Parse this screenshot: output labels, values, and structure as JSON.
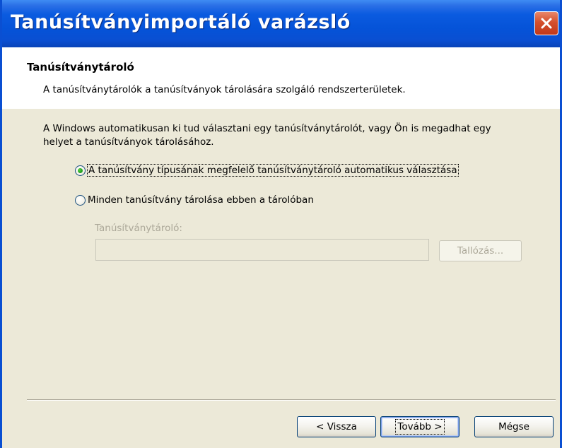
{
  "window": {
    "title": "Tanúsítványimportáló varázsló",
    "close_icon": "close-icon"
  },
  "header": {
    "title": "Tanúsítványtároló",
    "subtitle": "A tanúsítványtárolók a tanúsítványok tárolására szolgáló rendszerterületek."
  },
  "body": {
    "intro": "A Windows automatikusan ki tud választani egy tanúsítványtárolót, vagy Ön is megadhat egy helyet a tanúsítványok tárolásához.",
    "options": [
      {
        "label": "A tanúsítvány típusának megfelelő tanúsítványtároló automatikus választása",
        "checked": true
      },
      {
        "label": "Minden tanúsítvány tárolása ebben a tárolóban",
        "checked": false
      }
    ],
    "store_label": "Tanúsítványtároló:",
    "store_value": "",
    "browse_label": "Tallózás..."
  },
  "footer": {
    "back_label": "< Vissza",
    "next_label": "Tovább >",
    "cancel_label": "Mégse"
  },
  "colors": {
    "titlebar": "#0553d8",
    "dialog_bg": "#ece9d8",
    "close_button": "#d4502d",
    "radio_dot": "#21a121"
  }
}
